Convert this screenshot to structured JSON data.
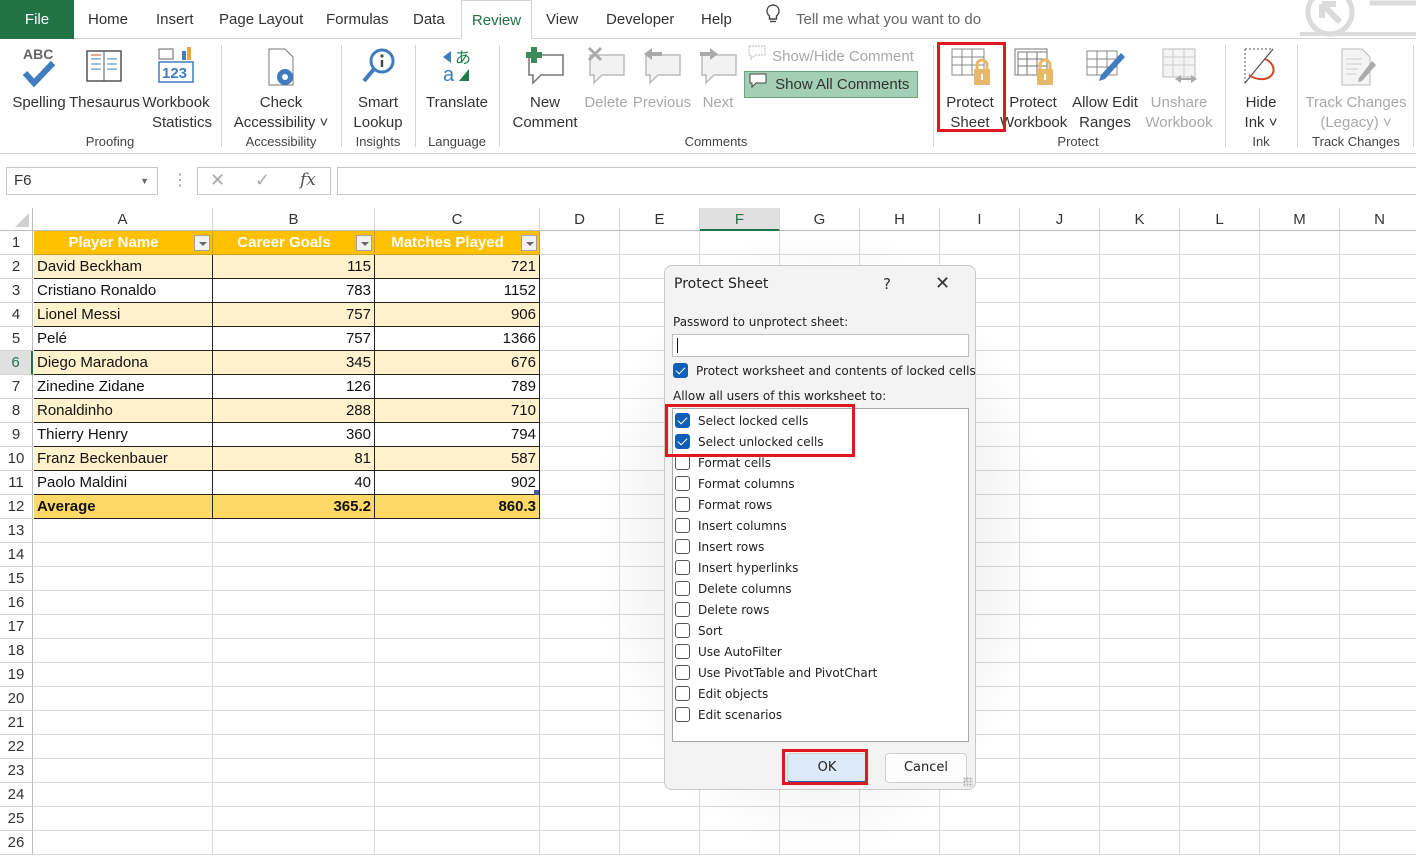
{
  "tabs": [
    {
      "label": "File"
    },
    {
      "label": "Home"
    },
    {
      "label": "Insert"
    },
    {
      "label": "Page Layout"
    },
    {
      "label": "Formulas"
    },
    {
      "label": "Data"
    },
    {
      "label": "Review"
    },
    {
      "label": "View"
    },
    {
      "label": "Developer"
    },
    {
      "label": "Help"
    }
  ],
  "active_tab": "Review",
  "tell_me": "Tell me what you want to do",
  "ribbon": {
    "proofing": {
      "label": "Proofing",
      "spelling": "Spelling",
      "thesaurus": "Thesaurus",
      "wb_stats_1": "Workbook",
      "wb_stats_2": "Statistics"
    },
    "accessibility": {
      "label": "Accessibility",
      "check_1": "Check",
      "check_2": "Accessibility ˅"
    },
    "insights": {
      "label": "Insights",
      "smart_1": "Smart",
      "smart_2": "Lookup"
    },
    "language": {
      "label": "Language",
      "translate": "Translate"
    },
    "comments": {
      "label": "Comments",
      "new_1": "New",
      "new_2": "Comment",
      "delete": "Delete",
      "previous": "Previous",
      "next": "Next",
      "show_hide": "Show/Hide Comment",
      "show_all": "Show All Comments"
    },
    "protect": {
      "label": "Protect",
      "sheet_1": "Protect",
      "sheet_2": "Sheet",
      "wb_1": "Protect",
      "wb_2": "Workbook",
      "allow_1": "Allow Edit",
      "allow_2": "Ranges",
      "unshare_1": "Unshare",
      "unshare_2": "Workbook"
    },
    "ink": {
      "label": "Ink",
      "hide_1": "Hide",
      "hide_2": "Ink ˅"
    },
    "track": {
      "label": "Track Changes",
      "tc_1": "Track Changes",
      "tc_2": "(Legacy) ˅"
    }
  },
  "formula_bar": {
    "name_box": "F6",
    "formula": "",
    "fx": "fx"
  },
  "columns": [
    "A",
    "B",
    "C",
    "D",
    "E",
    "F",
    "G",
    "H",
    "I",
    "J",
    "K",
    "L",
    "M",
    "N"
  ],
  "selected_column": "F",
  "selected_row": 6,
  "rows": [
    1,
    2,
    3,
    4,
    5,
    6,
    7,
    8,
    9,
    10,
    11,
    12,
    13,
    14,
    15,
    16,
    17,
    18,
    19,
    20,
    21,
    22,
    23,
    24,
    25,
    26
  ],
  "table": {
    "headers": [
      "Player Name",
      "Career Goals",
      "Matches Played"
    ],
    "rows": [
      [
        "David Beckham",
        "115",
        "721"
      ],
      [
        "Cristiano Ronaldo",
        "783",
        "1152"
      ],
      [
        "Lionel Messi",
        "757",
        "906"
      ],
      [
        "Pelé",
        "757",
        "1366"
      ],
      [
        "Diego Maradona",
        "345",
        "676"
      ],
      [
        "Zinedine Zidane",
        "126",
        "789"
      ],
      [
        "Ronaldinho",
        "288",
        "710"
      ],
      [
        "Thierry Henry",
        "360",
        "794"
      ],
      [
        "Franz Beckenbauer",
        "81",
        "587"
      ],
      [
        "Paolo Maldini",
        "40",
        "902"
      ]
    ],
    "average": [
      "Average",
      "365.2",
      "860.3"
    ]
  },
  "dialog": {
    "title": "Protect Sheet",
    "help": "?",
    "password_label": "Password to unprotect sheet:",
    "password_value": "",
    "protect_contents_label": "Protect worksheet and contents of locked cells",
    "protect_contents_checked": true,
    "allow_label": "Allow all users of this worksheet to:",
    "options": [
      {
        "label": "Select locked cells",
        "checked": true
      },
      {
        "label": "Select unlocked cells",
        "checked": true
      },
      {
        "label": "Format cells",
        "checked": false
      },
      {
        "label": "Format columns",
        "checked": false
      },
      {
        "label": "Format rows",
        "checked": false
      },
      {
        "label": "Insert columns",
        "checked": false
      },
      {
        "label": "Insert rows",
        "checked": false
      },
      {
        "label": "Insert hyperlinks",
        "checked": false
      },
      {
        "label": "Delete columns",
        "checked": false
      },
      {
        "label": "Delete rows",
        "checked": false
      },
      {
        "label": "Sort",
        "checked": false
      },
      {
        "label": "Use AutoFilter",
        "checked": false
      },
      {
        "label": "Use PivotTable and PivotChart",
        "checked": false
      },
      {
        "label": "Edit objects",
        "checked": false
      },
      {
        "label": "Edit scenarios",
        "checked": false
      }
    ],
    "ok": "OK",
    "cancel": "Cancel"
  },
  "colors": {
    "excel_green": "#217346",
    "header_gold": "#ffc000",
    "band": "#fff2cc",
    "avg": "#ffd966",
    "highlight_red": "#e0191f",
    "check_blue": "#0f5fb8"
  }
}
